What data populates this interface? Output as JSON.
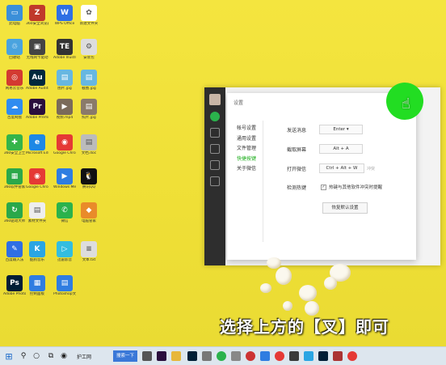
{
  "desktop_icons": [
    {
      "label": "此电脑",
      "color": "#3b8fd9",
      "glyph": "▭"
    },
    {
      "label": "360安全浏览器",
      "color": "#c0392b",
      "glyph": "Z"
    },
    {
      "label": "WPS Office",
      "color": "#2f6fe4",
      "glyph": "W"
    },
    {
      "label": "新建文件夹",
      "color": "#ffffff",
      "glyph": "✿"
    },
    {
      "label": "回收站",
      "color": "#4aa3df",
      "glyph": "♲"
    },
    {
      "label": "无线网卡驱动",
      "color": "#444444",
      "glyph": "▣"
    },
    {
      "label": "Adobe Illustrator",
      "color": "#333333",
      "glyph": "TE"
    },
    {
      "label": "安装包",
      "color": "#dddddd",
      "glyph": "⚙"
    },
    {
      "label": "网易云音乐",
      "color": "#d33a31",
      "glyph": "◎"
    },
    {
      "label": "Adobe Audition",
      "color": "#00293d",
      "glyph": "Au"
    },
    {
      "label": "图片.jpg",
      "color": "#67b7e1",
      "glyph": "▤"
    },
    {
      "label": "截图.jpg",
      "color": "#67b7e1",
      "glyph": "▤"
    },
    {
      "label": "百度网盘",
      "color": "#2f8cf0",
      "glyph": "☁"
    },
    {
      "label": "Adobe Premiere Pro",
      "color": "#2a0e3d",
      "glyph": "Pr"
    },
    {
      "label": "视频.mp4",
      "color": "#7a6a5a",
      "glyph": "▶"
    },
    {
      "label": "照片.jpg",
      "color": "#8a7a6a",
      "glyph": "▤"
    },
    {
      "label": "360安全卫士",
      "color": "#35b44a",
      "glyph": "✚"
    },
    {
      "label": "Microsoft Edge",
      "color": "#1e88e5",
      "glyph": "e"
    },
    {
      "label": "Google Chrome",
      "color": "#e53935",
      "glyph": "◉"
    },
    {
      "label": "文档.doc",
      "color": "#bbbbbb",
      "glyph": "▤"
    },
    {
      "label": "360软件管家",
      "color": "#2ba84a",
      "glyph": "▦"
    },
    {
      "label": "Google Chrome",
      "color": "#e53935",
      "glyph": "◉"
    },
    {
      "label": "Windows Media Player",
      "color": "#2f7de1",
      "glyph": "▶"
    },
    {
      "label": "腾讯QQ",
      "color": "#111111",
      "glyph": "🐧"
    },
    {
      "label": "360驱动大师",
      "color": "#2aa84a",
      "glyph": "↻"
    },
    {
      "label": "素材文件夹",
      "color": "#eeeeee",
      "glyph": "▤"
    },
    {
      "label": "微信",
      "color": "#2bb24c",
      "glyph": "✆"
    },
    {
      "label": "电脑管家",
      "color": "#e98b2a",
      "glyph": "◆"
    },
    {
      "label": "百度输入法",
      "color": "#2f6fe4",
      "glyph": "✎"
    },
    {
      "label": "酷狗音乐",
      "color": "#2aa5e3",
      "glyph": "K"
    },
    {
      "label": "迅雷影音",
      "color": "#33bde0",
      "glyph": "▷"
    },
    {
      "label": "文本.txt",
      "color": "#dddddd",
      "glyph": "≡"
    },
    {
      "label": "Adobe Photoshop",
      "color": "#001e36",
      "glyph": "Ps"
    },
    {
      "label": "控制面板",
      "color": "#2f7de1",
      "glyph": "▦"
    },
    {
      "label": "Photoshop文件",
      "color": "#2f7de1",
      "glyph": "▤"
    }
  ],
  "wechat_sidebar": [
    "avatar",
    "chat-icon",
    "contacts-icon",
    "favorites-icon",
    "files-icon",
    "moments-icon"
  ],
  "settings": {
    "title": "设置",
    "close_glyph": "×",
    "menu": [
      "帐号设置",
      "通用设置",
      "文件管理",
      "快捷按键",
      "关于微信"
    ],
    "active_menu_index": 3,
    "rows": [
      {
        "label": "发送消息",
        "value": "Enter ▾"
      },
      {
        "label": "截取屏幕",
        "value": "Alt + A"
      },
      {
        "label": "打开微信",
        "value": "Ctrl + Alt + W"
      },
      {
        "label": "检测热键",
        "value": ""
      }
    ],
    "shortcut_hint": "冲突",
    "conflict_text": "热键与其他软件冲突时提醒",
    "conflict_checked": "✓",
    "restore_button": "恢复默认设置"
  },
  "caption": "选择上方的【叉】即可",
  "taskbar": {
    "search_label": "搜索一下",
    "app_label": "护工网",
    "accent": "#3a78d8"
  }
}
